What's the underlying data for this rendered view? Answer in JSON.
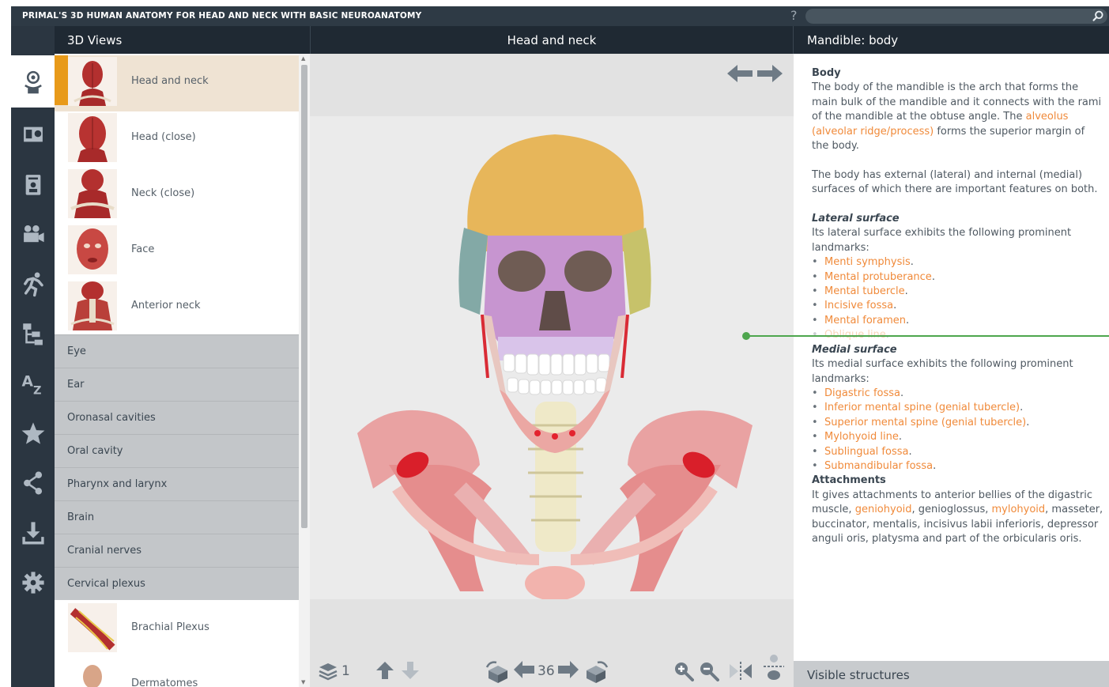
{
  "app": {
    "title": "PRIMAL'S 3D HUMAN ANATOMY FOR HEAD AND NECK WITH BASIC NEUROANATOMY",
    "help_icon": "?",
    "search_placeholder": ""
  },
  "headers": {
    "left": "3D Views",
    "center": "Head and neck",
    "right": "Mandible: body"
  },
  "sidebar": {
    "icons": [
      "views-3d-icon",
      "slides-icon",
      "quiz-icon",
      "video-icon",
      "animation-icon",
      "hierarchy-icon",
      "a-z-index-icon",
      "favorites-icon",
      "share-icon",
      "download-icon",
      "settings-icon"
    ],
    "selected": "views-3d-icon"
  },
  "views": {
    "top_items": [
      {
        "label": "Head and neck",
        "selected": true
      },
      {
        "label": "Head (close)",
        "selected": false
      },
      {
        "label": "Neck (close)",
        "selected": false
      },
      {
        "label": "Face",
        "selected": false
      },
      {
        "label": "Anterior neck",
        "selected": false
      }
    ],
    "categories": [
      "Eye",
      "Ear",
      "Oronasal cavities",
      "Oral cavity",
      "Pharynx and larynx",
      "Brain",
      "Cranial nerves",
      "Cervical plexus"
    ],
    "bottom_items": [
      {
        "label": "Brachial Plexus"
      },
      {
        "label": "Dermatomes"
      }
    ]
  },
  "viewport": {
    "layer_count": "1",
    "rotation_step": "36"
  },
  "info": {
    "heading_body": "Body",
    "p1_a": "The body of the mandible is the arch that forms the main bulk of the mandible and it connects with the rami of the mandible at the obtuse angle. The ",
    "p1_link": "alveolus (alveolar ridge/process)",
    "p1_b": " forms the superior margin of the body.",
    "p2": "The body has external (lateral) and internal (medial) surfaces of which there are important features on both.",
    "lateral_heading": "Lateral surface",
    "lateral_intro": "Its lateral surface exhibits the following prominent landmarks:",
    "lateral_items": [
      "Menti symphysis",
      "Mental protuberance",
      "Mental tubercle",
      "Incisive fossa",
      "Mental foramen"
    ],
    "lateral_faded_item": "Oblique line",
    "medial_heading": "Medial surface",
    "medial_intro": "Its medial surface exhibits the following prominent landmarks:",
    "medial_items": [
      "Digastric fossa",
      "Inferior mental spine (genial tubercle)",
      "Superior mental spine (genial tubercle)",
      "Mylohyoid line",
      "Sublingual fossa",
      "Submandibular fossa"
    ],
    "attachments_heading": "Attachments",
    "att_a": "It gives attachments to anterior bellies of the digastric muscle, ",
    "att_link1": "geniohyoid",
    "att_b": ", genioglossus, ",
    "att_link2": "mylohyoid",
    "att_c": ", masseter, buccinator, mentalis, incisivus labii inferioris, depressor anguli oris, platysma and part of the orbicularis oris.",
    "visible_structures": "Visible structures"
  },
  "colors": {
    "title_bar": "#2e3a45",
    "header": "#1f2933",
    "sidebar": "#2b3641",
    "selected_accent": "#e89a1a",
    "link": "#f08a3a",
    "leader_line": "#4ea64e"
  }
}
